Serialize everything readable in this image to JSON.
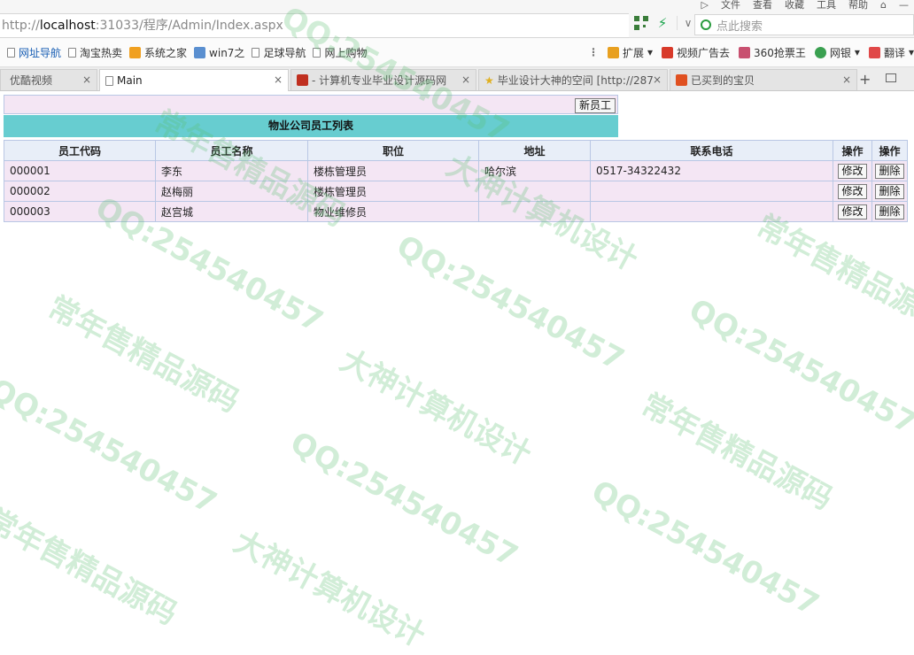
{
  "browser": {
    "top_menu": [
      "文件",
      "查看",
      "收藏",
      "工具",
      "帮助"
    ],
    "url_prefix": "http://",
    "url_host": "localhost",
    "url_rest": ":31033/程序/Admin/Index.aspx",
    "search_placeholder": "点此搜索",
    "bookmarks": [
      "网址导航",
      "淘宝热卖",
      "系统之家",
      "win7之",
      "足球导航",
      "网上购物"
    ],
    "bookmarks_right": [
      "扩展",
      "视频广告去",
      "360抢票王",
      "网银",
      "翻译"
    ],
    "tabs": [
      {
        "label": "优酷视频"
      },
      {
        "label": "Main"
      },
      {
        "label": "- 计算机专业毕业设计源码网"
      },
      {
        "label": "毕业设计大神的空间 [http://287"
      },
      {
        "label": "已买到的宝贝"
      }
    ]
  },
  "page": {
    "new_button": "新员工",
    "caption": "物业公司员工列表",
    "columns": [
      "员工代码",
      "员工名称",
      "职位",
      "地址",
      "联系电话",
      "操作",
      "操作"
    ],
    "rows": [
      {
        "code": "000001",
        "name": "李东",
        "position": "楼栋管理员",
        "address": "哈尔滨",
        "phone": "0517-34322432"
      },
      {
        "code": "000002",
        "name": "赵梅丽",
        "position": "楼栋管理员",
        "address": "",
        "phone": ""
      },
      {
        "code": "000003",
        "name": "赵宫城",
        "position": "物业维修员",
        "address": "",
        "phone": ""
      }
    ],
    "edit_label": "修改",
    "delete_label": "删除"
  },
  "watermark": [
    "QQ:254540457",
    "常年售精品源码",
    "大神计算机设计"
  ],
  "colors": {
    "caption_bg": "#67cdd0",
    "row_bg": "#f4e6f4",
    "header_bg": "#e8eef8",
    "border": "#b9c7e4"
  }
}
